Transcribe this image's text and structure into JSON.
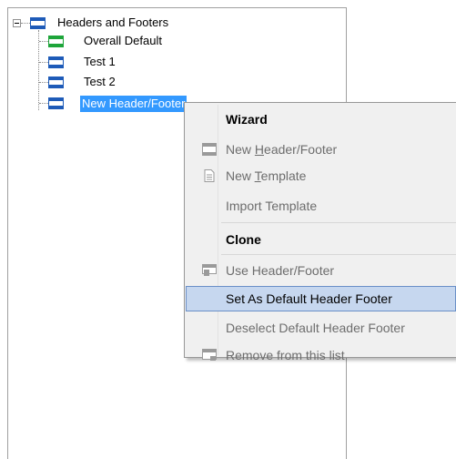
{
  "tree": {
    "root": {
      "label": "Headers and Footers",
      "icon": "header-footer-icon",
      "expanded": true
    },
    "children": [
      {
        "label": "Overall Default",
        "icon": "default-header-footer-icon",
        "selected": false
      },
      {
        "label": "Test 1",
        "icon": "header-footer-icon",
        "selected": false
      },
      {
        "label": "Test 2",
        "icon": "header-footer-icon",
        "selected": false
      },
      {
        "label": "New Header/Footer",
        "icon": "header-footer-icon",
        "selected": true
      }
    ],
    "colors": {
      "icon_blue": "#1e5bb8",
      "icon_green": "#1ea53a",
      "selection": "#3399ff"
    }
  },
  "context_menu": {
    "items": [
      {
        "label": "Wizard",
        "enabled": true,
        "icon": null
      },
      {
        "label": "New Header/Footer",
        "mnemonic": "H",
        "enabled": false,
        "icon": "header-footer-icon"
      },
      {
        "label": "New Template",
        "mnemonic": "T",
        "enabled": false,
        "icon": "document-icon"
      },
      {
        "label": "Import Template",
        "enabled": false,
        "icon": null
      },
      {
        "label": "Clone",
        "enabled": true,
        "icon": null
      },
      {
        "label": "Use Header/Footer",
        "enabled": false,
        "icon": "apply-header-footer-icon"
      },
      {
        "label": "Set As Default Header Footer",
        "enabled": true,
        "highlighted": true,
        "icon": null
      },
      {
        "label": "Deselect Default Header Footer",
        "enabled": false,
        "icon": null
      },
      {
        "label": "Remove from this list",
        "enabled": false,
        "icon": "remove-icon"
      }
    ],
    "colors": {
      "highlight_bg": "#c6d7ef",
      "highlight_border": "#6a8fc7",
      "disabled_text": "#6d6d6d"
    }
  }
}
